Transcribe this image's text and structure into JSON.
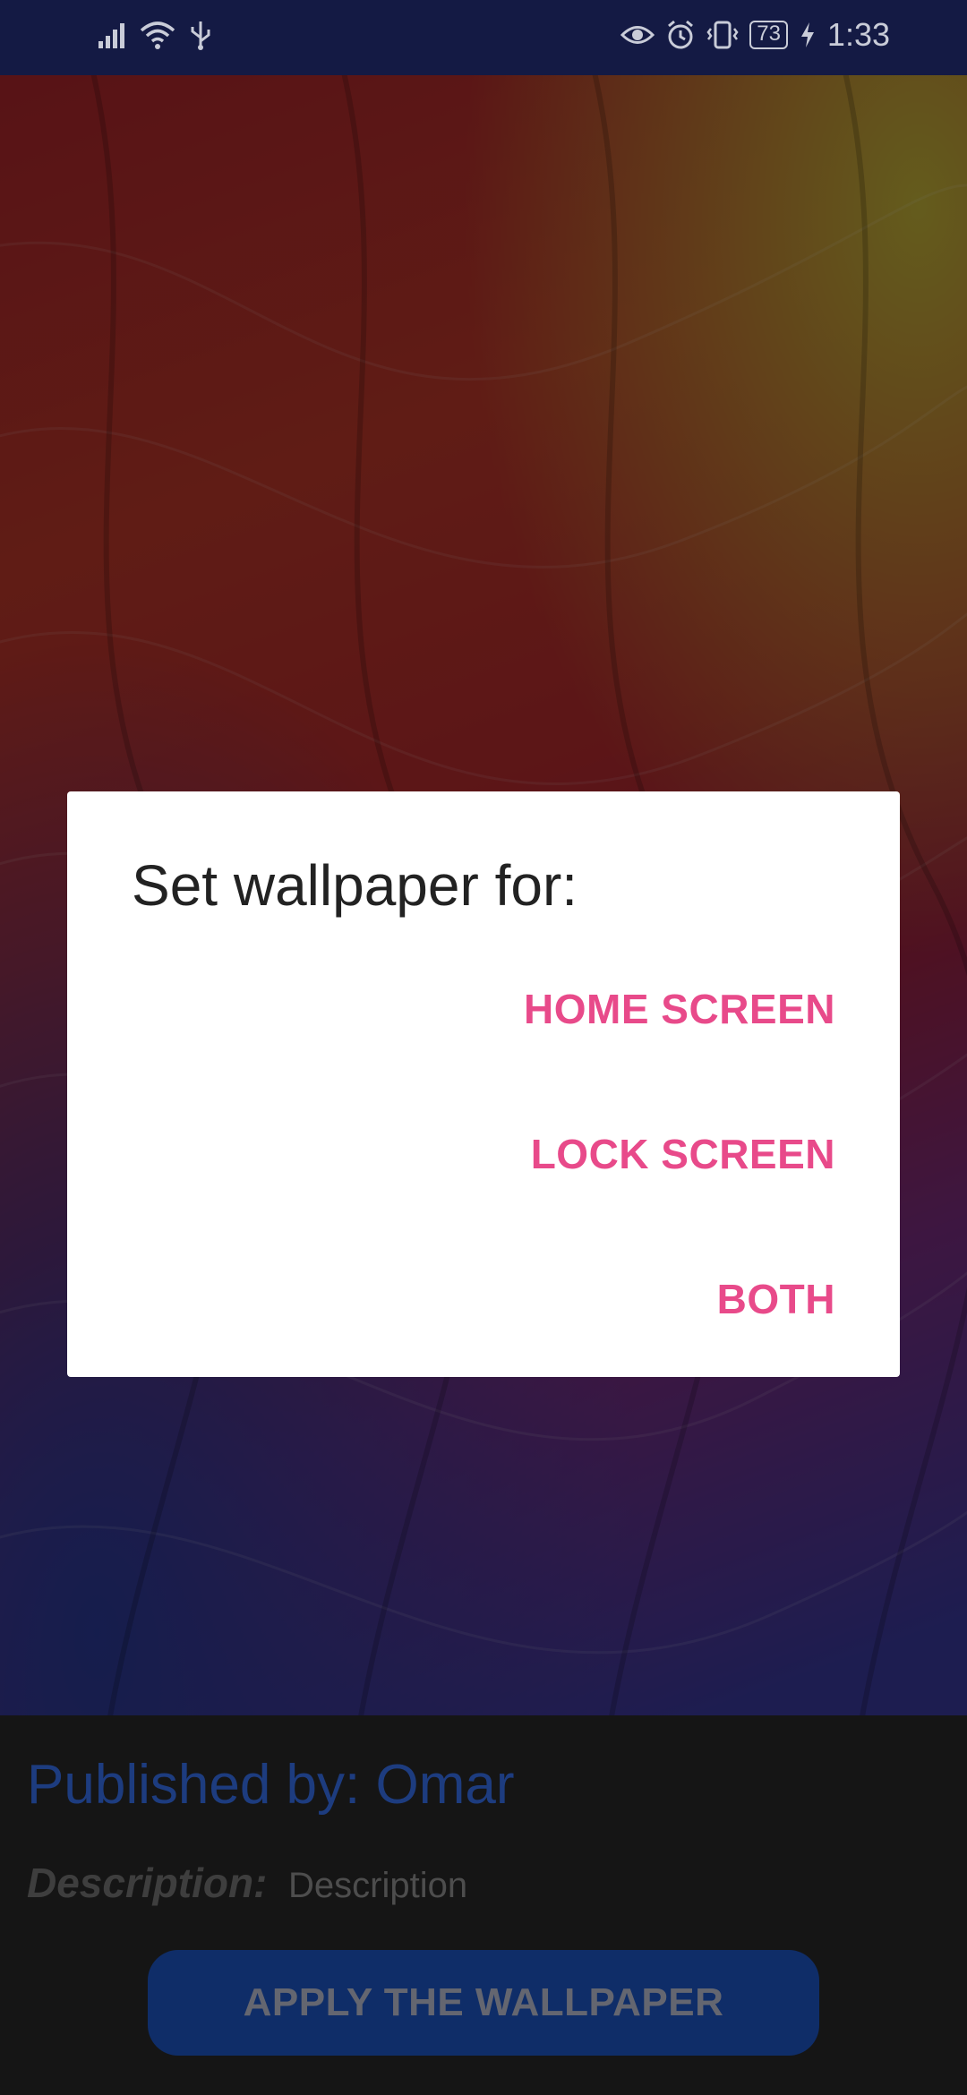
{
  "status_bar": {
    "battery": "73",
    "time": "1:33",
    "icons": [
      "signal-icon",
      "wifi-icon",
      "usb-icon",
      "eye-icon",
      "alarm-icon",
      "vibrate-icon",
      "battery-icon",
      "charging-icon"
    ]
  },
  "details": {
    "publisher": "Published by: Omar",
    "description_label": "Description:",
    "description_value": "Description",
    "apply_button": "APPLY THE WALLPAPER"
  },
  "dialog": {
    "title": "Set wallpaper for:",
    "options": [
      "HOME SCREEN",
      "LOCK SCREEN",
      "BOTH"
    ]
  },
  "colors": {
    "status_bar_bg": "#141a44",
    "accent_pink": "#e84a8a",
    "publisher_blue": "#3b78ff",
    "button_blue": "#1e5bd1"
  }
}
